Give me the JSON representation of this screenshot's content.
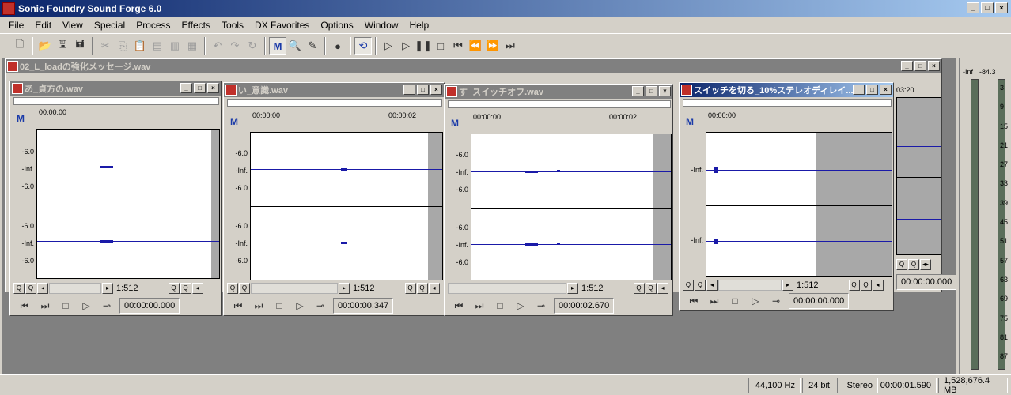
{
  "app": {
    "title": "Sonic Foundry Sound Forge 6.0"
  },
  "menu": [
    "File",
    "Edit",
    "View",
    "Special",
    "Process",
    "Effects",
    "Tools",
    "DX Favorites",
    "Options",
    "Window",
    "Help"
  ],
  "toolbar_icons": [
    "new-icon",
    "open-icon",
    "save-icon",
    "save-all-icon",
    "cut-icon",
    "copy-icon",
    "paste-icon",
    "paste-special-icon",
    "mix-icon",
    "crop-icon",
    "undo-icon",
    "redo-icon",
    "repeat-icon",
    "edit-tool-icon",
    "magnify-tool-icon",
    "pencil-tool-icon",
    "record-icon",
    "loop-icon",
    "play-all-icon",
    "play-icon",
    "pause-icon",
    "stop-icon",
    "go-start-icon",
    "rewind-icon",
    "forward-icon",
    "go-end-icon"
  ],
  "window_buttons": {
    "min": "_",
    "max": "□",
    "close": "×"
  },
  "background_window": {
    "title": "02_L_loadの強化メッセージ.wav",
    "ruler_time": "03:20",
    "counter": "00:00:00.000"
  },
  "windows": [
    {
      "title": "あ_貞方の.wav",
      "ruler_start": "00:00:00",
      "ruler_end": "",
      "db_top": "-6.0",
      "db_mid": "-Inf.",
      "db_bot": "-6.0",
      "zoom": "1:512",
      "counter": "00:00:00.000"
    },
    {
      "title": "い_意識.wav",
      "ruler_start": "00:00:00",
      "ruler_end": "00:00:02",
      "db_top": "-6.0",
      "db_mid": "-Inf.",
      "db_bot": "-6.0",
      "zoom": "1:512",
      "counter": "00:00:00.347"
    },
    {
      "title": "す_スイッチオフ.wav",
      "ruler_start": "00:00:00",
      "ruler_end": "00:00:02",
      "db_top": "-6.0",
      "db_mid": "-Inf.",
      "db_bot": "-6.0",
      "zoom": "1:512",
      "counter": "00:00:02.670"
    },
    {
      "title": "スイッチを切る_10%ステレオディレイ...",
      "ruler_start": "00:00:00",
      "ruler_end": "",
      "db_top": "",
      "db_mid": "-Inf.",
      "db_bot": "",
      "zoom": "1:512",
      "counter": "00:00:00.000"
    }
  ],
  "meter": {
    "top_label": "-Inf",
    "top_right": "-84.3",
    "scale": [
      "3",
      "9",
      "15",
      "21",
      "27",
      "33",
      "39",
      "45",
      "51",
      "57",
      "63",
      "69",
      "75",
      "81",
      "87"
    ]
  },
  "status": {
    "rate": "44,100 Hz",
    "bits": "24 bit",
    "channels": "Stereo",
    "time": "00:00:01.590",
    "free": "1,528,676.4 MB"
  },
  "accent": "#0a246a"
}
